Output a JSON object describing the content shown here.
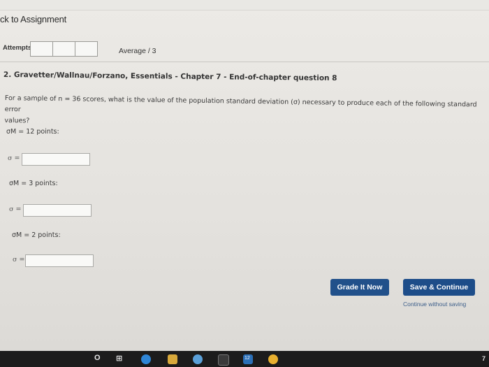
{
  "nav": {
    "back_link": "ck to Assignment"
  },
  "attempts": {
    "label": "Attempts",
    "average": "Average / 3"
  },
  "question": {
    "title": "2. Gravetter/Wallnau/Forzano, Essentials - Chapter 7 - End-of-chapter question 8",
    "prompt_line1": "For a sample of n = 36 scores, what is the value of the population standard deviation (σ) necessary to produce each of the following standard error",
    "prompt_line2": "values?",
    "parts": [
      {
        "label": "σM = 12 points:",
        "sigma": "σ =",
        "value": ""
      },
      {
        "label": "σM = 3 points:",
        "sigma": "σ =",
        "value": ""
      },
      {
        "label": "σM = 2 points:",
        "sigma": "σ =",
        "value": ""
      }
    ]
  },
  "actions": {
    "grade": "Grade It Now",
    "save": "Save & Continue",
    "continue": "Continue without saving"
  },
  "taskbar": {
    "search_glyph": "O",
    "taskview_glyph": "⊞",
    "badge": "12",
    "edge_text": "7"
  },
  "colors": {
    "button": "#21508a",
    "taskbar": "#1c1c1c"
  }
}
